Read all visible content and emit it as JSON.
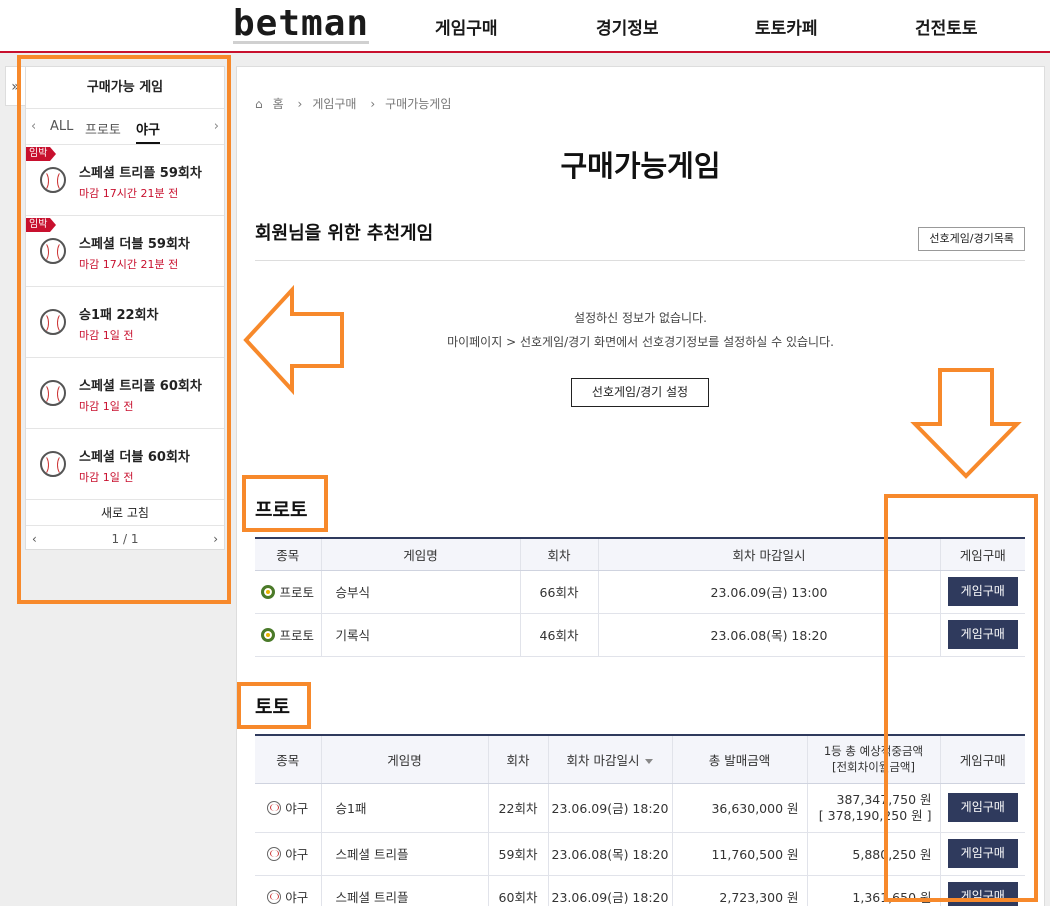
{
  "header": {
    "logo": "betman",
    "nav": [
      "게임구매",
      "경기정보",
      "토토카페",
      "건전토토"
    ]
  },
  "side_toggle": "»",
  "left_panel": {
    "title": "구매가능 게임",
    "tabs": [
      "ALL",
      "프로토",
      "야구"
    ],
    "active_tab": "야구",
    "items": [
      {
        "badge": "임박",
        "name": "스페셜 트리플 59회차",
        "time": "마감 17시간 21분 전"
      },
      {
        "badge": "임박",
        "name": "스페셜 더블 59회차",
        "time": "마감 17시간 21분 전"
      },
      {
        "badge": "",
        "name": "승1패 22회차",
        "time": "마감 1일 전"
      },
      {
        "badge": "",
        "name": "스페셜 트리플 60회차",
        "time": "마감 1일 전"
      },
      {
        "badge": "",
        "name": "스페셜 더블 60회차",
        "time": "마감 1일 전"
      }
    ],
    "refresh": "새로 고침",
    "page": "1 / 1"
  },
  "breadcrumb": [
    "홈",
    "게임구매",
    "구매가능게임"
  ],
  "page_title": "구매가능게임",
  "recommend": {
    "title": "회원님을 위한 추천게임",
    "pref_button": "선호게임/경기목록",
    "msg1": "설정하신 정보가 없습니다.",
    "msg2": "마이페이지 > 선호게임/경기 화면에서 선호경기정보를 설정하실 수 있습니다.",
    "set_button": "선호게임/경기 설정"
  },
  "proto": {
    "title": "프로토",
    "headers": [
      "종목",
      "게임명",
      "회차",
      "회차 마감일시",
      "게임구매"
    ],
    "rows": [
      {
        "sport": "프로토",
        "game": "승부식",
        "round": "66회차",
        "deadline": "23.06.09(금) 13:00",
        "buy": "게임구매"
      },
      {
        "sport": "프로토",
        "game": "기록식",
        "round": "46회차",
        "deadline": "23.06.08(목) 18:20",
        "buy": "게임구매"
      }
    ]
  },
  "toto": {
    "title": "토토",
    "headers": [
      "종목",
      "게임명",
      "회차",
      "회차 마감일시",
      "총 발매금액",
      "1등 총 예상적중금액",
      "[전회차이월금액]",
      "게임구매"
    ],
    "rows": [
      {
        "sport": "야구",
        "game": "승1패",
        "round": "22회차",
        "deadline": "23.06.09(금) 18:20",
        "sales": "36,630,000 원",
        "expected": "387,347,750 원",
        "carry": "[ 378,190,250 원 ]",
        "buy": "게임구매"
      },
      {
        "sport": "야구",
        "game": "스페셜 트리플",
        "round": "59회차",
        "deadline": "23.06.08(목) 18:20",
        "sales": "11,760,500 원",
        "expected": "5,880,250 원",
        "carry": "",
        "buy": "게임구매"
      },
      {
        "sport": "야구",
        "game": "스페셜 트리플",
        "round": "60회차",
        "deadline": "23.06.09(금) 18:20",
        "sales": "2,723,300 원",
        "expected": "1,361,650 원",
        "carry": "",
        "buy": "게임구매"
      }
    ]
  },
  "colors": {
    "brand_red": "#c8102e",
    "navy": "#2f3a5d",
    "annotation_orange": "#f7892b"
  }
}
